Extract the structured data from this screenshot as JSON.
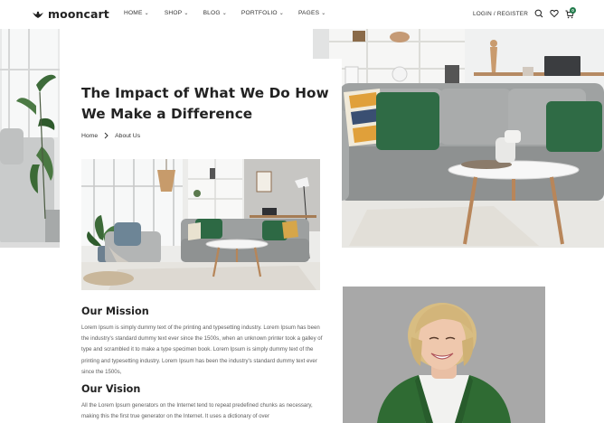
{
  "header": {
    "logo_text": "mooncart",
    "nav": [
      {
        "label": "HOME"
      },
      {
        "label": "SHOP"
      },
      {
        "label": "BLOG"
      },
      {
        "label": "PORTFOLIO"
      },
      {
        "label": "PAGES"
      }
    ],
    "login_label": "LOGIN / REGISTER",
    "cart_count": "0"
  },
  "hero": {
    "title": "The Impact of What We Do How We Make a Difference",
    "breadcrumb": {
      "home": "Home",
      "current": "About Us"
    }
  },
  "mission": {
    "heading": "Our Mission",
    "text": "Lorem Ipsum is simply dummy text of the printing and typesetting industry. Lorem Ipsum has been the industry's standard dummy text ever since the 1500s, when an unknown printer took a galley of type and scrambled it to make a type specimen book. Lorem Ipsum is simply dummy text of the printing and typesetting industry. Lorem Ipsum has been the industry's standard dummy text ever since the 1500s,"
  },
  "vision": {
    "heading": "Our Vision",
    "text": "All the Lorem Ipsum generators on the Internet tend to repeat predefined chunks as necessary, making this the first true generator on the Internet. It uses a dictionary of over"
  }
}
